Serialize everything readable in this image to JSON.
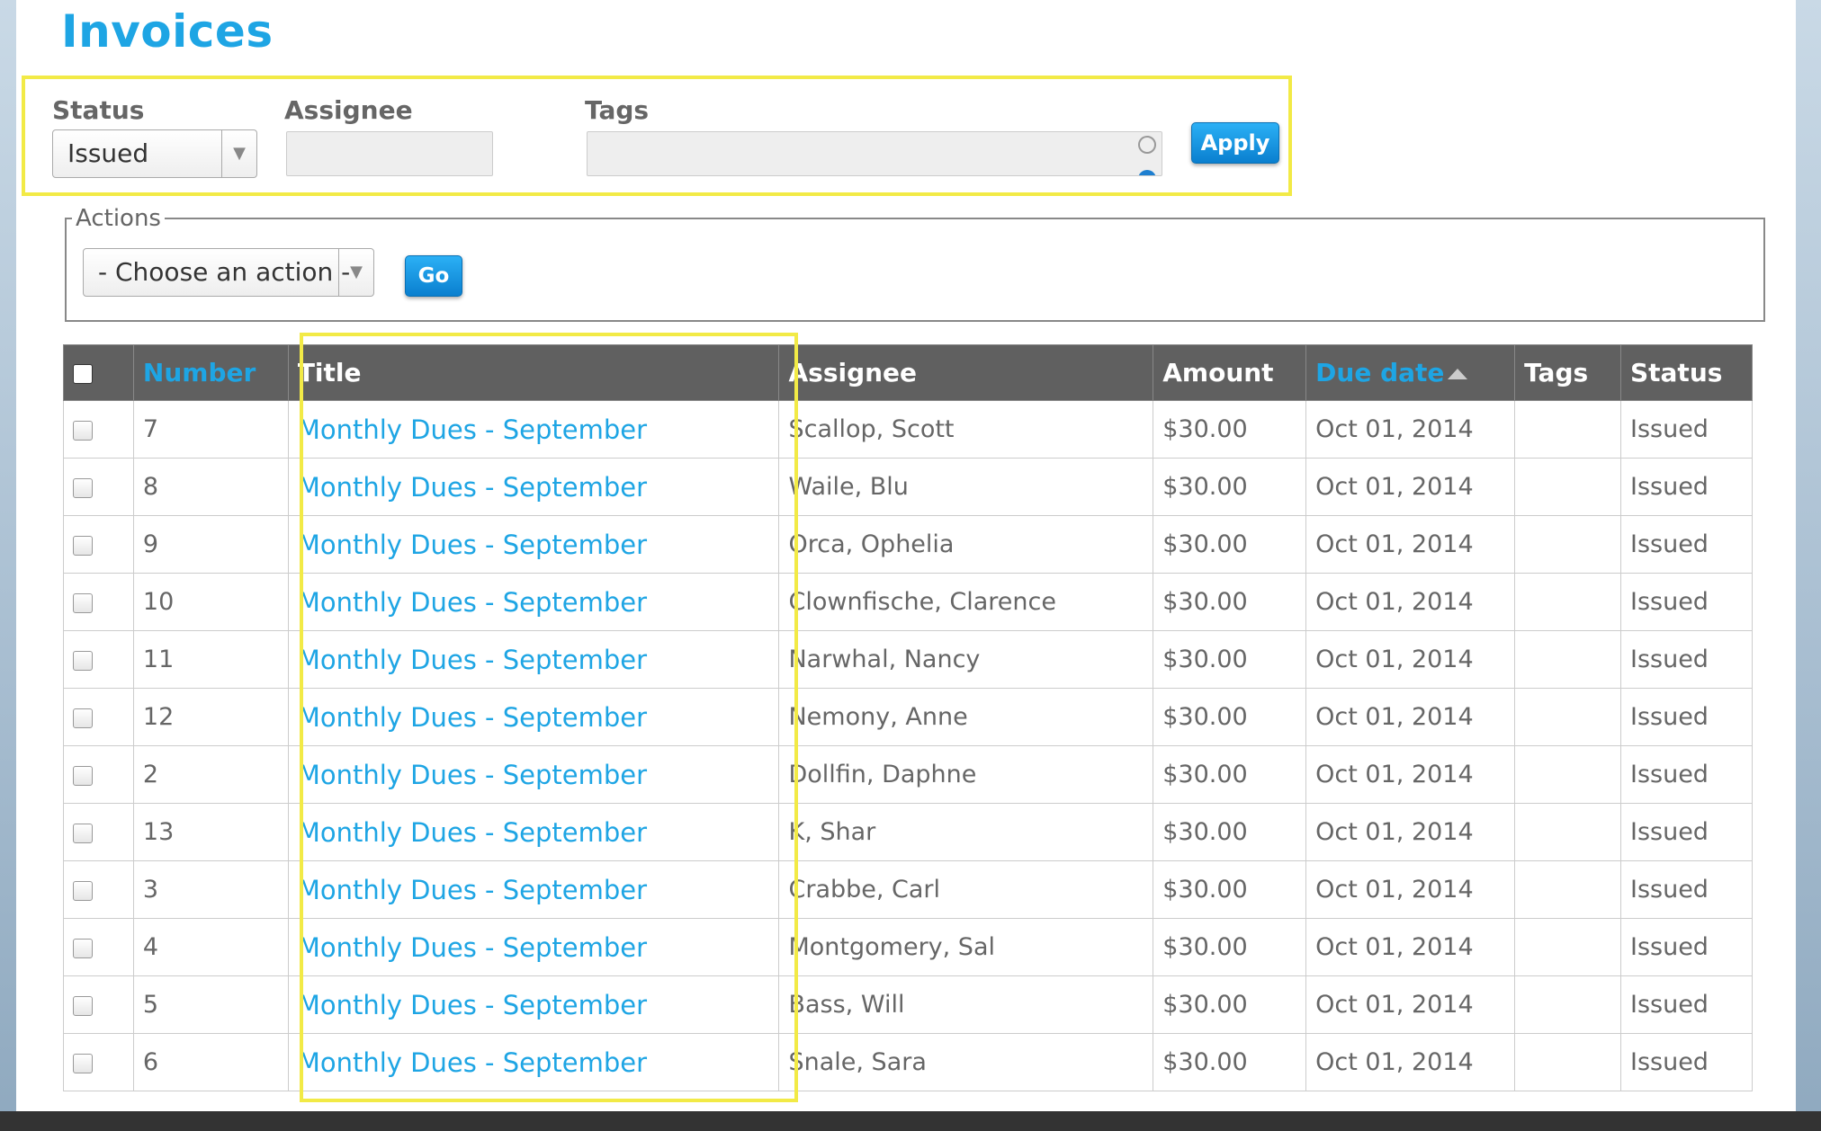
{
  "page": {
    "title": "Invoices"
  },
  "filters": {
    "status_label": "Status",
    "status_value": "Issued",
    "assignee_label": "Assignee",
    "assignee_value": "",
    "tags_label": "Tags",
    "tags_value": "",
    "apply_label": "Apply"
  },
  "actions": {
    "legend": "Actions",
    "select_value": "- Choose an action -",
    "go_label": "Go"
  },
  "table": {
    "headers": {
      "number": "Number",
      "title": "Title",
      "assignee": "Assignee",
      "amount": "Amount",
      "due_date": "Due date",
      "tags": "Tags",
      "status": "Status"
    },
    "rows": [
      {
        "number": "7",
        "title": "Monthly Dues - September",
        "assignee": "Scallop, Scott",
        "amount": "$30.00",
        "due": "Oct 01, 2014",
        "tags": "",
        "status": "Issued"
      },
      {
        "number": "8",
        "title": "Monthly Dues - September",
        "assignee": "Waile, Blu",
        "amount": "$30.00",
        "due": "Oct 01, 2014",
        "tags": "",
        "status": "Issued"
      },
      {
        "number": "9",
        "title": "Monthly Dues - September",
        "assignee": "Orca, Ophelia",
        "amount": "$30.00",
        "due": "Oct 01, 2014",
        "tags": "",
        "status": "Issued"
      },
      {
        "number": "10",
        "title": "Monthly Dues - September",
        "assignee": "Clownfische, Clarence",
        "amount": "$30.00",
        "due": "Oct 01, 2014",
        "tags": "",
        "status": "Issued"
      },
      {
        "number": "11",
        "title": "Monthly Dues - September",
        "assignee": "Narwhal, Nancy",
        "amount": "$30.00",
        "due": "Oct 01, 2014",
        "tags": "",
        "status": "Issued"
      },
      {
        "number": "12",
        "title": "Monthly Dues - September",
        "assignee": "Nemony, Anne",
        "amount": "$30.00",
        "due": "Oct 01, 2014",
        "tags": "",
        "status": "Issued"
      },
      {
        "number": "2",
        "title": "Monthly Dues - September",
        "assignee": "Dollfin, Daphne",
        "amount": "$30.00",
        "due": "Oct 01, 2014",
        "tags": "",
        "status": "Issued"
      },
      {
        "number": "13",
        "title": "Monthly Dues - September",
        "assignee": "K, Shar",
        "amount": "$30.00",
        "due": "Oct 01, 2014",
        "tags": "",
        "status": "Issued"
      },
      {
        "number": "3",
        "title": "Monthly Dues - September",
        "assignee": "Crabbe, Carl",
        "amount": "$30.00",
        "due": "Oct 01, 2014",
        "tags": "",
        "status": "Issued"
      },
      {
        "number": "4",
        "title": "Monthly Dues - September",
        "assignee": "Montgomery, Sal",
        "amount": "$30.00",
        "due": "Oct 01, 2014",
        "tags": "",
        "status": "Issued"
      },
      {
        "number": "5",
        "title": "Monthly Dues - September",
        "assignee": "Bass, Will",
        "amount": "$30.00",
        "due": "Oct 01, 2014",
        "tags": "",
        "status": "Issued"
      },
      {
        "number": "6",
        "title": "Monthly Dues - September",
        "assignee": "Snale, Sara",
        "amount": "$30.00",
        "due": "Oct 01, 2014",
        "tags": "",
        "status": "Issued"
      }
    ]
  },
  "colors": {
    "accent": "#1ea5e4",
    "highlight": "#f2ea46",
    "header_bg": "#606060",
    "button": "#0a7fcf"
  }
}
